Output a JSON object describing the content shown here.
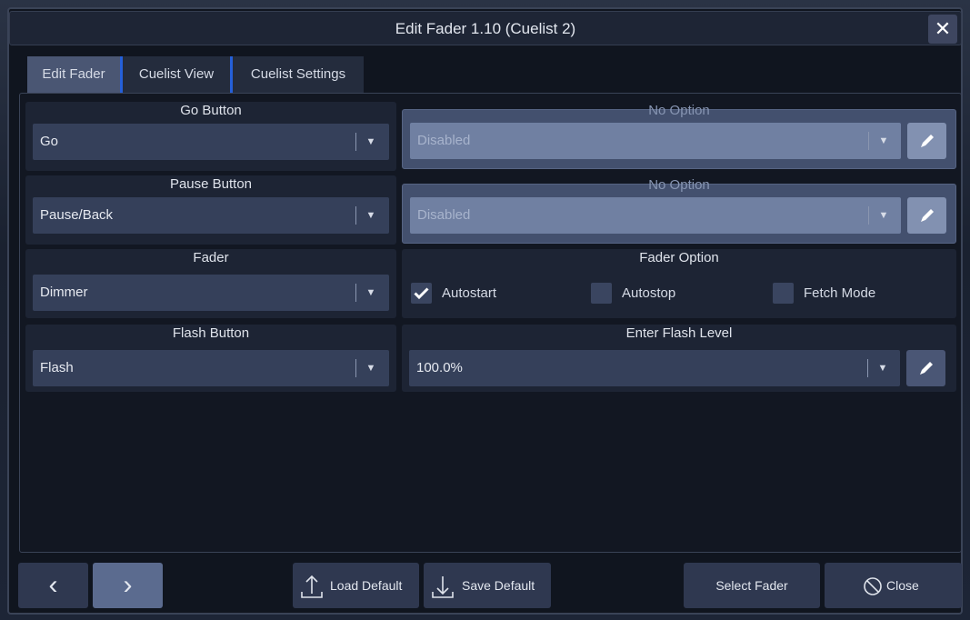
{
  "dialog": {
    "title": "Edit Fader 1.10 (Cuelist 2)",
    "close_glyph": "✕"
  },
  "tabs": [
    {
      "label": "Edit Fader",
      "active": true
    },
    {
      "label": "Cuelist View",
      "active": false
    },
    {
      "label": "Cuelist Settings",
      "active": false
    }
  ],
  "go_button": {
    "label": "Go Button",
    "value": "Go"
  },
  "go_option": {
    "label": "No Option",
    "value": "Disabled"
  },
  "pause_button": {
    "label": "Pause Button",
    "value": "Pause/Back"
  },
  "pause_option": {
    "label": "No Option",
    "value": "Disabled"
  },
  "fader": {
    "label": "Fader",
    "value": "Dimmer"
  },
  "fader_option": {
    "label": "Fader Option",
    "checkboxes": [
      {
        "label": "Autostart",
        "checked": true
      },
      {
        "label": "Autostop",
        "checked": false
      },
      {
        "label": "Fetch Mode",
        "checked": false
      }
    ]
  },
  "flash_button": {
    "label": "Flash Button",
    "value": "Flash"
  },
  "flash_level": {
    "label": "Enter Flash Level",
    "value": "100.0%"
  },
  "footer": {
    "prev_glyph": "‹",
    "next_glyph": "›",
    "load_default": "Load Default",
    "save_default": "Save Default",
    "select_fader": "Select Fader",
    "close": "Close"
  },
  "icons": {
    "chevron": "chevron-down-icon",
    "edit": "pencil-icon",
    "check": "checkmark-icon",
    "upload": "upload-icon",
    "download": "download-icon",
    "close": "no-entry-icon"
  },
  "colors": {
    "tab_accent": "#2560d9",
    "highlight_section": "#43506e",
    "dialog_bg": "#10151f"
  }
}
